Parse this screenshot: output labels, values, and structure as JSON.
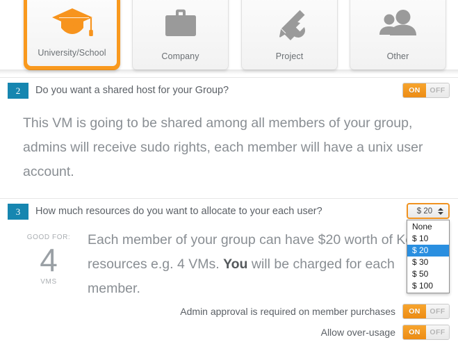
{
  "group_type": {
    "cards": [
      {
        "label": "University/School",
        "icon": "graduation-cap-icon",
        "selected": true
      },
      {
        "label": "Company",
        "icon": "briefcase-icon",
        "selected": false
      },
      {
        "label": "Project",
        "icon": "wrench-screwdriver-icon",
        "selected": false
      },
      {
        "label": "Other",
        "icon": "users-icon",
        "selected": false
      }
    ]
  },
  "section2": {
    "number": "2",
    "question": "Do you want a shared host for your Group?",
    "toggle": {
      "on_label": "ON",
      "off_label": "OFF",
      "value": "ON"
    },
    "body": "This VM is going to be shared among all members of your group, admins will receive sudo rights, each member will have a unix user account."
  },
  "section3": {
    "number": "3",
    "question": "How much resources do you want to allocate to your each user?",
    "select": {
      "value": "$ 20",
      "expanded": true,
      "options": [
        "None",
        "$ 10",
        "$ 20",
        "$ 30",
        "$ 50",
        "$ 100"
      ],
      "selected_option": "$ 20"
    },
    "good_for": {
      "top_label": "GOOD FOR:",
      "number": "4",
      "unit_label": "VMS"
    },
    "body_part1": "Each member of your group can have $20 worth of Koding resources e.g. 4 VMs. ",
    "body_bold": "You",
    "body_part2": " will be charged for each member.",
    "options": [
      {
        "label": "Admin approval is required on member purchases",
        "toggle": {
          "on_label": "ON",
          "off_label": "OFF",
          "value": "ON"
        }
      },
      {
        "label": "Allow over-usage",
        "toggle": {
          "on_label": "ON",
          "off_label": "OFF",
          "value": "ON"
        }
      }
    ]
  },
  "colors": {
    "accent_orange": "#f0921f",
    "badge_blue": "#1686b0",
    "highlight_blue": "#2a8fe0",
    "icon_gray": "#9a9a9a",
    "text_gray": "#898e93"
  }
}
